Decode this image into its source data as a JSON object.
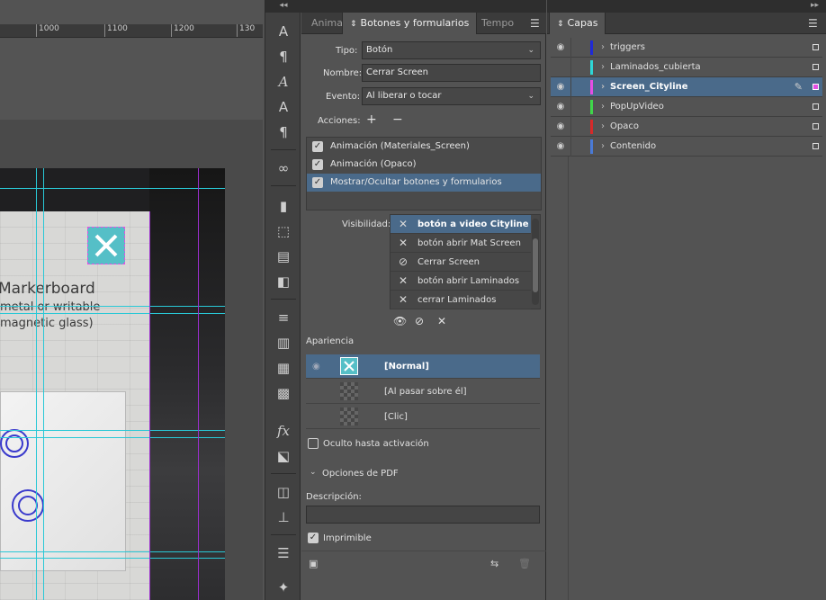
{
  "ruler": {
    "ticks": [
      "1000",
      "1100",
      "1200",
      "130"
    ]
  },
  "canvas": {
    "title": "Markerboard",
    "subtitle1": "metal or writable",
    "subtitle2": "magnetic glass)"
  },
  "toolstrip": {
    "icons": [
      "character-icon",
      "paragraph-icon",
      "glyphs-icon",
      "character-styles-icon",
      "paragraph-styles-icon",
      "links-icon",
      "bookmarks-icon",
      "object-states-icon",
      "media-icon",
      "page-transitions-icon",
      "stroke-icon",
      "gradient-icon",
      "swatches-icon",
      "color-icon",
      "effects-icon",
      "interactive-icon",
      "layers-stack-icon",
      "align-icon",
      "properties-icon",
      "liquid-layout-icon"
    ]
  },
  "buttons_panel": {
    "tabs": [
      "Anima",
      "Botones y formularios",
      "Tempo"
    ],
    "active_tab_index": 1,
    "tipo_label": "Tipo:",
    "tipo_value": "Botón",
    "nombre_label": "Nombre:",
    "nombre_value": "Cerrar Screen",
    "evento_label": "Evento:",
    "evento_value": "Al liberar o tocar",
    "acciones_label": "Acciones:",
    "actions": [
      {
        "label": "Animación (Materiales_Screen)",
        "checked": true,
        "selected": false
      },
      {
        "label": "Animación (Opaco)",
        "checked": true,
        "selected": false
      },
      {
        "label": "Mostrar/Ocultar botones y formularios",
        "checked": true,
        "selected": true
      }
    ],
    "visibilidad_label": "Visibilidad:",
    "visibility": [
      {
        "label": "botón a video Cityline",
        "state": "hide",
        "selected": true
      },
      {
        "label": "botón abrir Mat Screen",
        "state": "hide",
        "selected": false
      },
      {
        "label": "Cerrar Screen",
        "state": "ignore",
        "selected": false
      },
      {
        "label": "botón abrir Laminados",
        "state": "hide",
        "selected": false
      },
      {
        "label": "cerrar Laminados",
        "state": "hide",
        "selected": false
      }
    ],
    "apariencia_label": "Apariencia",
    "appearances": [
      {
        "label": "[Normal]",
        "selected": true
      },
      {
        "label": "[Al pasar sobre él]",
        "selected": false
      },
      {
        "label": "[Clic]",
        "selected": false
      }
    ],
    "oculto_label": "Oculto hasta activación",
    "oculto_checked": false,
    "pdf_options_label": "Opciones de PDF",
    "descripcion_label": "Descripción:",
    "descripcion_value": "",
    "imprimible_label": "Imprimible",
    "imprimible_checked": true
  },
  "layers_panel": {
    "tab": "Capas",
    "layers": [
      {
        "name": "triggers",
        "color": "#1f2ad6",
        "visible": true,
        "selected": false
      },
      {
        "name": "Laminados_cubierta",
        "color": "#2ed6d6",
        "visible": false,
        "selected": false
      },
      {
        "name": "Screen_Cityline",
        "color": "#e44ee4",
        "visible": true,
        "selected": true
      },
      {
        "name": "PopUpVideo",
        "color": "#3fd64a",
        "visible": true,
        "selected": false
      },
      {
        "name": "Opaco",
        "color": "#d62a2a",
        "visible": true,
        "selected": false
      },
      {
        "name": "Contenido",
        "color": "#4a7ad6",
        "visible": true,
        "selected": false
      }
    ]
  }
}
